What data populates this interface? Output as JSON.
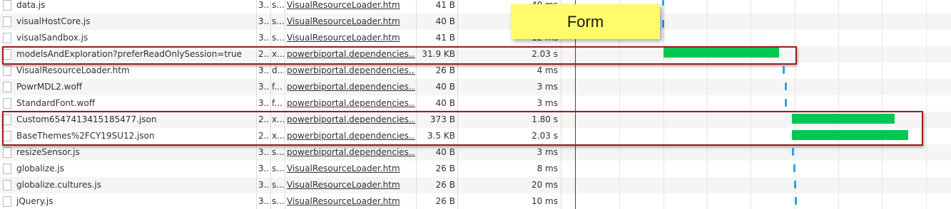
{
  "annotation": {
    "label": "Form"
  },
  "colors": {
    "bar": "#00c853",
    "tick": "#29a6e0",
    "highlight_border": "#9b1c1c",
    "callout_bg": "#fffb6a"
  },
  "requests": [
    {
      "name": "data.js",
      "status": "3...",
      "type": "s...",
      "initiator": "VisualResourceLoader.htm",
      "size": "41 B",
      "time": "40 ms"
    },
    {
      "name": "visualHostCore.js",
      "status": "3...",
      "type": "s...",
      "initiator": "VisualResourceLoader.htm",
      "size": "40 B",
      "time": ""
    },
    {
      "name": "visualSandbox.js",
      "status": "3...",
      "type": "s...",
      "initiator": "VisualResourceLoader.htm",
      "size": "41 B",
      "time": "12 ms"
    },
    {
      "name": "modelsAndExploration?preferReadOnlySession=true",
      "status": "2...",
      "type": "x...",
      "initiator": "powerbiportal.dependencies....",
      "size": "31.9 KB",
      "time": "2.03 s"
    },
    {
      "name": "VisualResourceLoader.htm",
      "status": "3...",
      "type": "d...",
      "initiator": "powerbiportal.dependencies....",
      "size": "26 B",
      "time": "4 ms"
    },
    {
      "name": "PowrMDL2.woff",
      "status": "3...",
      "type": "f...",
      "initiator": "powerbiportal.dependencies....",
      "size": "40 B",
      "time": "3 ms"
    },
    {
      "name": "StandardFont.woff",
      "status": "3...",
      "type": "f...",
      "initiator": "powerbiportal.dependencies....",
      "size": "40 B",
      "time": "3 ms"
    },
    {
      "name": "Custom6547413415185477.json",
      "status": "2...",
      "type": "x...",
      "initiator": "powerbiportal.dependencies....",
      "size": "373 B",
      "time": "1.80 s"
    },
    {
      "name": "BaseThemes%2FCY19SU12.json",
      "status": "2...",
      "type": "x...",
      "initiator": "powerbiportal.dependencies....",
      "size": "3.5 KB",
      "time": "2.03 s"
    },
    {
      "name": "resizeSensor.js",
      "status": "3...",
      "type": "s...",
      "initiator": "powerbiportal.dependencies....",
      "size": "40 B",
      "time": "3 ms"
    },
    {
      "name": "globalize.js",
      "status": "3...",
      "type": "s...",
      "initiator": "VisualResourceLoader.htm",
      "size": "26 B",
      "time": "8 ms"
    },
    {
      "name": "globalize.cultures.js",
      "status": "3...",
      "type": "s...",
      "initiator": "VisualResourceLoader.htm",
      "size": "26 B",
      "time": "20 ms"
    },
    {
      "name": "jQuery.js",
      "status": "3...",
      "type": "s...",
      "initiator": "VisualResourceLoader.htm",
      "size": "26 B",
      "time": "10 ms"
    }
  ]
}
